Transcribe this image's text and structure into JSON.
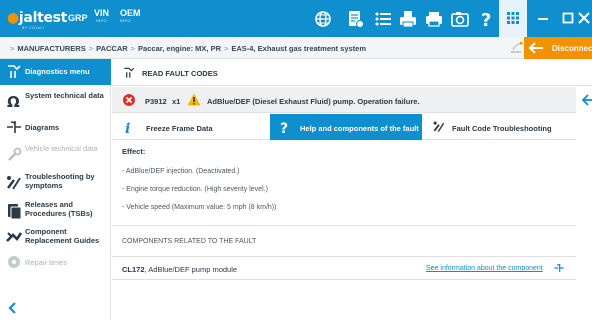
{
  "app": {
    "logo": "jaltest",
    "logo_sub": "BY COJALI",
    "mode_grp": "GRP",
    "vin_label": "VIN",
    "vin_sub": "INFO",
    "oem_label": "OEM",
    "oem_sub": "INFO"
  },
  "toolbar_icons": [
    "globe-icon",
    "report-icon",
    "list-icon",
    "printer-document-icon",
    "printer-icon",
    "camera-icon",
    "help-icon",
    "apps-grid-icon"
  ],
  "window_controls": [
    "minimize",
    "maximize",
    "close"
  ],
  "breadcrumb": {
    "root": "MANUFACTURERS",
    "items": [
      "PACCAR",
      "Paccar, engine: MX, PR",
      "EAS-4, Exhaust gas treatment system"
    ]
  },
  "disconnect_label": "Disconnect",
  "sidebar": {
    "items": [
      {
        "label": "Diagnostics menu",
        "icon": "diagnostics-icon",
        "state": "active"
      },
      {
        "label": "System technical data",
        "icon": "ohm-icon",
        "state": "normal"
      },
      {
        "label": "Diagrams",
        "icon": "wiring-diagram-icon",
        "state": "normal"
      },
      {
        "label": "Vehicle technical data",
        "icon": "wrench-icon",
        "state": "disabled"
      },
      {
        "label": "Troubleshooting by symptoms",
        "icon": "troubleshooting-icon",
        "state": "normal"
      },
      {
        "label": "Releases and Procedures (TSBs)",
        "icon": "releases-icon",
        "state": "normal"
      },
      {
        "label": "Component Replacement Guides",
        "icon": "replacement-icon",
        "state": "normal"
      },
      {
        "label": "Repair times",
        "icon": "repair-times-icon",
        "state": "disabled"
      }
    ]
  },
  "section_title": "READ FAULT CODES",
  "fault": {
    "code": "P3912",
    "count": "x1",
    "description": "AdBlue/DEF (Diesel Exhaust Fluid) pump. Operation failure."
  },
  "tabs": [
    {
      "label": "Freeze Frame Data",
      "icon": "info-icon"
    },
    {
      "label": "Help and components of the fault",
      "icon": "question-icon",
      "active": true
    },
    {
      "label": "Fault Code Troubleshooting",
      "icon": "troubleshooting-icon"
    }
  ],
  "effect": {
    "title": "Effect:",
    "lines": [
      "- AdBlue/DEF injection. (Deactivated.)",
      "- Engine torque reduction. (High severity level.)",
      "- Vehicle speed (Maximum value: 5 mph (8 km/h))"
    ]
  },
  "components": {
    "header": "COMPONENTS RELATED TO THE FAULT",
    "items": [
      {
        "code": "CL172",
        "name": ", AdBlue/DEF pump module",
        "link": "See information about the component"
      }
    ]
  },
  "colors": {
    "primary_blue": "#0f8fce",
    "orange": "#f39200",
    "error_red": "#d9342b",
    "warning_yellow": "#f5b800"
  }
}
